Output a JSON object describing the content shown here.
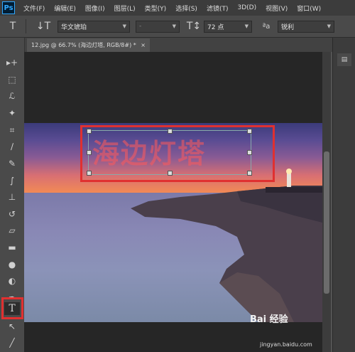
{
  "app": {
    "logo_text": "Ps"
  },
  "menu": [
    "文件(F)",
    "编辑(E)",
    "图像(I)",
    "图层(L)",
    "类型(Y)",
    "选择(S)",
    "滤镜(T)",
    "3D(D)",
    "视图(V)",
    "窗口(W)"
  ],
  "options": {
    "tool_icon_glyph": "T",
    "orient_icon_glyph": "↓T",
    "font_family": "华文琥珀",
    "font_style": "-",
    "size_icon_glyph": "T↕",
    "font_size": "72 点",
    "aa_icon_glyph": "ªa",
    "antialias": "锐利"
  },
  "document": {
    "tab_label": "12.jpg @ 66.7% (海边灯塔, RGB/8#) *",
    "tab_close": "×"
  },
  "canvas": {
    "text_layer": "海边灯塔"
  },
  "tools": [
    {
      "name": "move-tool",
      "glyph": "▸+"
    },
    {
      "name": "marquee-tool",
      "glyph": "⬚"
    },
    {
      "name": "lasso-tool",
      "glyph": "ℒ"
    },
    {
      "name": "magic-wand-tool",
      "glyph": "✦"
    },
    {
      "name": "crop-tool",
      "glyph": "⌗"
    },
    {
      "name": "eyedropper-tool",
      "glyph": "∕"
    },
    {
      "name": "healing-tool",
      "glyph": "✎"
    },
    {
      "name": "brush-tool",
      "glyph": "∫"
    },
    {
      "name": "stamp-tool",
      "glyph": "⊥"
    },
    {
      "name": "history-brush-tool",
      "glyph": "↺"
    },
    {
      "name": "eraser-tool",
      "glyph": "▱"
    },
    {
      "name": "gradient-tool",
      "glyph": "▬"
    },
    {
      "name": "blur-tool",
      "glyph": "●"
    },
    {
      "name": "dodge-tool",
      "glyph": "◐"
    },
    {
      "name": "pen-tool",
      "glyph": "✒"
    },
    {
      "name": "type-tool",
      "glyph": "T"
    },
    {
      "name": "path-selection-tool",
      "glyph": "↖"
    },
    {
      "name": "line-tool",
      "glyph": "╱"
    }
  ],
  "panel": {
    "button_glyph": "▤"
  },
  "watermark": {
    "brand": "Bai 经验",
    "url": "jingyan.baidu.com"
  },
  "colors": {
    "highlight": "#e03030",
    "ui_dark": "#3c3c3c"
  }
}
